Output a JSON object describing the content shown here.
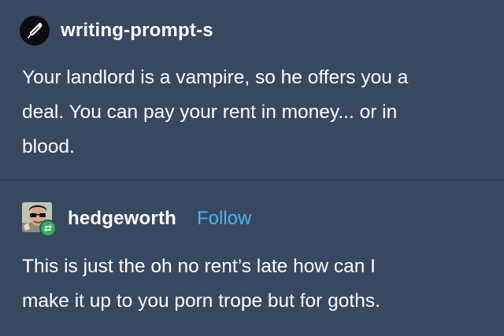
{
  "post": {
    "username": "writing-prompt-s",
    "avatar_icon": "quill-pen-icon",
    "text_line1": "Your landlord is a vampire, so he offers you a",
    "text_line2": "deal. You can pay your rent in money... or in",
    "text_line3": "blood."
  },
  "reblog": {
    "username": "hedgeworth",
    "follow_label": "Follow",
    "badge_icon": "reblog-icon",
    "text_line1": "This is just the oh no rent’s late how can I",
    "text_line2": "make it up to you porn trope but for goths."
  },
  "colors": {
    "background": "#394861",
    "divider": "#2c384b",
    "follow": "#4fb0f0",
    "reblog_badge": "#27b558"
  }
}
